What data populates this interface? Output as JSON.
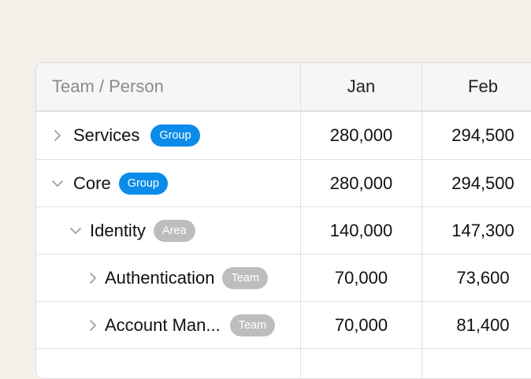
{
  "table": {
    "headers": {
      "name": "Team / Person",
      "jan": "Jan",
      "feb": "Feb"
    },
    "rows": [
      {
        "label": "Services",
        "badge": "Group",
        "expanded": false,
        "jan": "280,000",
        "feb": "294,500"
      },
      {
        "label": "Core",
        "badge": "Group",
        "expanded": true,
        "jan": "280,000",
        "feb": "294,500"
      },
      {
        "label": "Identity",
        "badge": "Area",
        "expanded": true,
        "jan": "140,000",
        "feb": "147,300"
      },
      {
        "label": "Authentication",
        "badge": "Team",
        "expanded": false,
        "jan": "70,000",
        "feb": "73,600"
      },
      {
        "label": "Account Man...",
        "badge": "Team",
        "expanded": false,
        "jan": "70,000",
        "feb": "81,400"
      }
    ]
  },
  "colors": {
    "background": "#f4f0e9",
    "group_badge": "#0b8bea",
    "muted_badge": "#bdbdbd",
    "header_bg": "#f6f6f6"
  },
  "icons": {
    "collapsed": "chevron-right-icon",
    "expanded": "chevron-down-icon"
  }
}
